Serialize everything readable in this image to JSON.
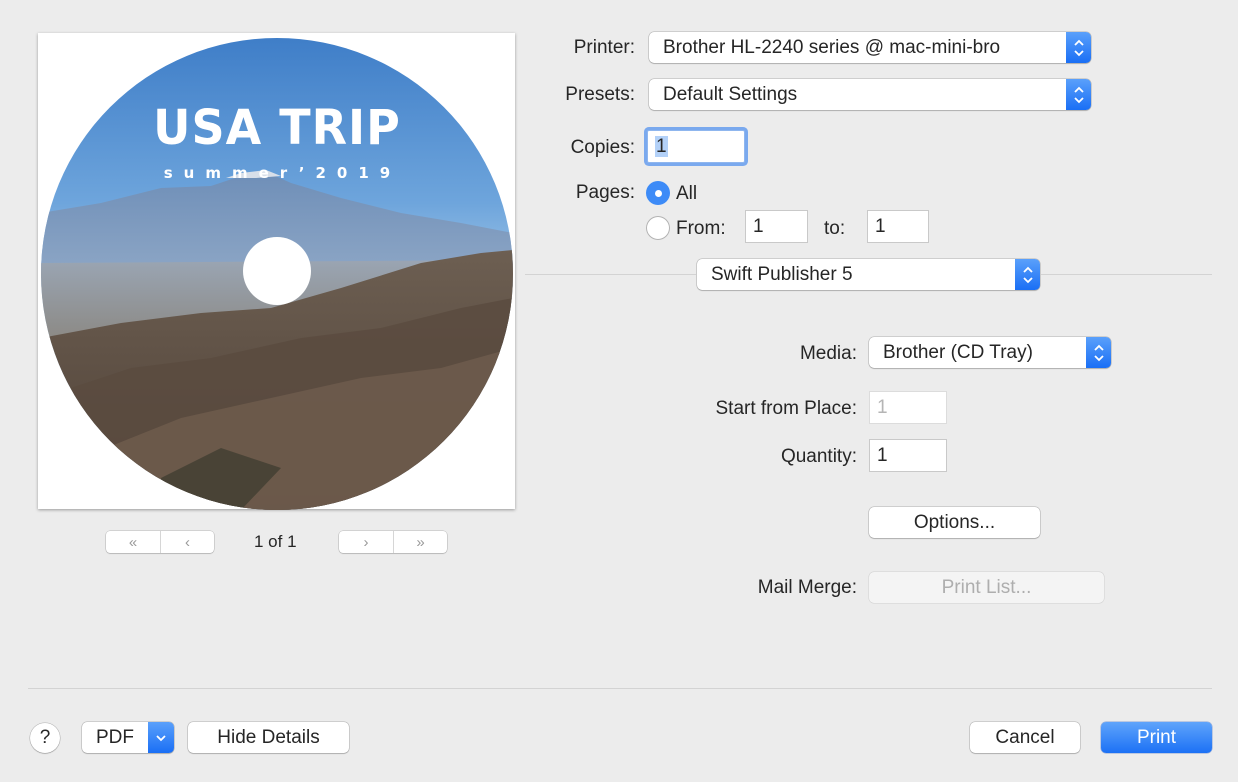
{
  "preview": {
    "disc_title": "USA TRIP",
    "disc_subtitle": "summer’2019",
    "pager": {
      "first_icon": "«",
      "prev_icon": "‹",
      "next_icon": "›",
      "last_icon": "»",
      "page_indicator": "1 of 1"
    }
  },
  "printer": {
    "label": "Printer:",
    "value": "Brother HL-2240 series @ mac-mini-bro"
  },
  "presets": {
    "label": "Presets:",
    "value": "Default Settings"
  },
  "copies": {
    "label": "Copies:",
    "value": "1"
  },
  "pages": {
    "label": "Pages:",
    "all_label": "All",
    "all_selected": true,
    "from_label": "From:",
    "from_value": "1",
    "to_label": "to:",
    "to_value": "1"
  },
  "section_popup": {
    "value": "Swift Publisher 5"
  },
  "media": {
    "label": "Media:",
    "value": "Brother (CD Tray)"
  },
  "start_from_place": {
    "label": "Start from Place:",
    "value": "1"
  },
  "quantity": {
    "label": "Quantity:",
    "value": "1"
  },
  "options_button": "Options...",
  "mail_merge": {
    "label": "Mail Merge:",
    "button": "Print List..."
  },
  "footer": {
    "help": "?",
    "pdf": "PDF",
    "hide_details": "Hide Details",
    "cancel": "Cancel",
    "print": "Print"
  },
  "colors": {
    "accent": "#1a6ff5",
    "background": "#ececec",
    "radio_selected": "#3d8bf7"
  }
}
